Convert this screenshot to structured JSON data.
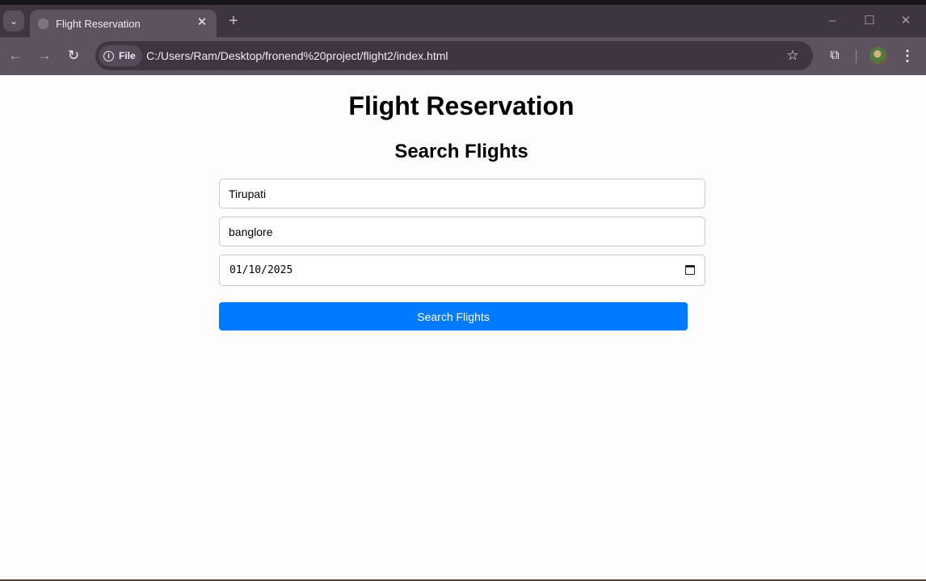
{
  "browser": {
    "tab_title": "Flight Reservation",
    "tab_close": "✕",
    "new_tab": "+",
    "file_chip": "File",
    "url": "C:/Users/Ram/Desktop/fronend%20project/flight2/index.html",
    "icons": [
      "tab-search-icon",
      "globe-icon",
      "close-icon",
      "plus-icon",
      "minimize-icon",
      "maximize-icon",
      "close-window-icon",
      "back-icon",
      "forward-icon",
      "reload-icon",
      "info-icon",
      "star-icon",
      "extensions-icon",
      "avatar",
      "menu-icon"
    ]
  },
  "page": {
    "title": "Flight Reservation",
    "search_heading": "Search Flights",
    "from_value": "Tirupati",
    "to_value": "banglore",
    "date_value": "01/10/2025",
    "search_button": "Search Flights",
    "button_color": "#007bff"
  }
}
